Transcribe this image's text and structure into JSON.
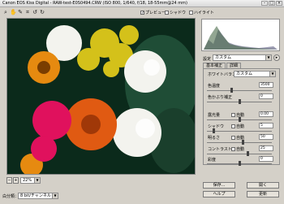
{
  "window": {
    "title": "Canon EOS Kiss Digital - RAW-test-E0S0494.CRW (ISO 800, 1/640, f/18, 18-55mm@24 mm)"
  },
  "toolbar": {
    "tools": [
      "magnifier-icon",
      "hand-icon",
      "eyedropper-icon",
      "crop-icon",
      "rotate-left-icon",
      "rotate-right-icon"
    ],
    "preview_label": "プレビュー",
    "shadow_label": "シャドウ",
    "highlight_label": "ハイライト"
  },
  "settings": {
    "label": "設定",
    "value": "カスタム"
  },
  "tabs": [
    "基本補正",
    "詳細"
  ],
  "white_balance": {
    "label": "ホワイトバランス",
    "value": "カスタム"
  },
  "adjust": [
    {
      "name": "色温度",
      "value": "3500",
      "auto": false,
      "level": 0.38
    },
    {
      "name": "色かぶり補正",
      "value": "0",
      "auto": false,
      "level": 0.5
    },
    {
      "name": "露光量",
      "value": "0.00",
      "auto": true,
      "level": 0.5
    },
    {
      "name": "シャドウ",
      "value": "5",
      "auto": true,
      "level": 0.1
    },
    {
      "name": "明るさ",
      "value": "50",
      "auto": true,
      "level": 0.55
    },
    {
      "name": "コントラスト",
      "value": "25",
      "auto": true,
      "level": 0.62
    },
    {
      "name": "彩度",
      "value": "0",
      "auto": false,
      "level": 0.5
    }
  ],
  "auto_label": "自動",
  "bottom": {
    "zoom": "22%",
    "wb_label": "白分類：",
    "wb_value": "8 bit/チャンネル"
  },
  "buttons": {
    "save": "保存...",
    "open": "開く",
    "help": "ヘルプ",
    "update": "更新"
  },
  "colors": {
    "bg": "#d4d0c8"
  }
}
